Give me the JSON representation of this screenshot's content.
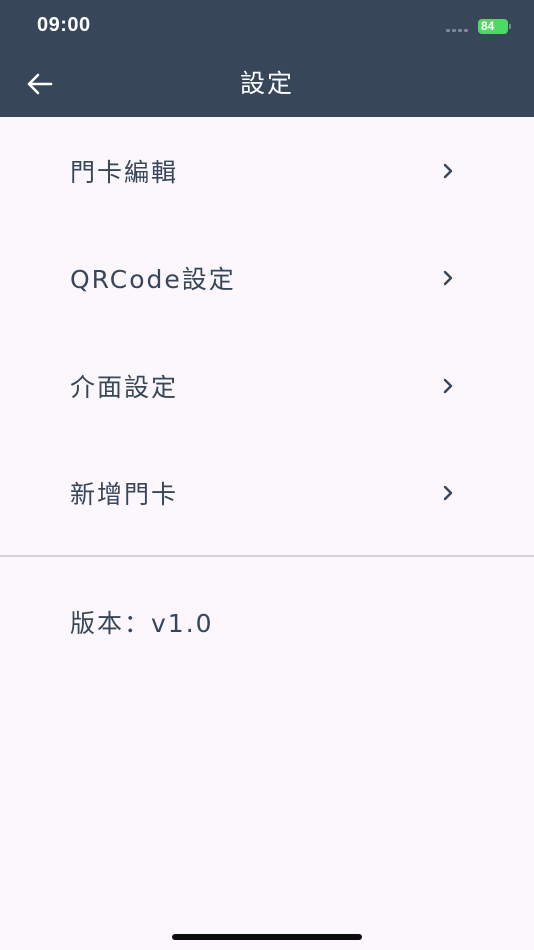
{
  "status_bar": {
    "time": "09:00",
    "battery": "84"
  },
  "header": {
    "title": "設定",
    "back_icon": "arrow-left-icon"
  },
  "menu": {
    "items": [
      {
        "label": "門卡編輯",
        "icon": "chevron-right-icon"
      },
      {
        "label": "QRCode設定",
        "icon": "chevron-right-icon"
      },
      {
        "label": "介面設定",
        "icon": "chevron-right-icon"
      },
      {
        "label": "新增門卡",
        "icon": "chevron-right-icon"
      }
    ]
  },
  "version": {
    "text": "版本：v1.0"
  },
  "colors": {
    "header_bg": "#374659",
    "page_bg": "#fbf7fd",
    "text": "#374659",
    "battery": "#4cd964"
  }
}
